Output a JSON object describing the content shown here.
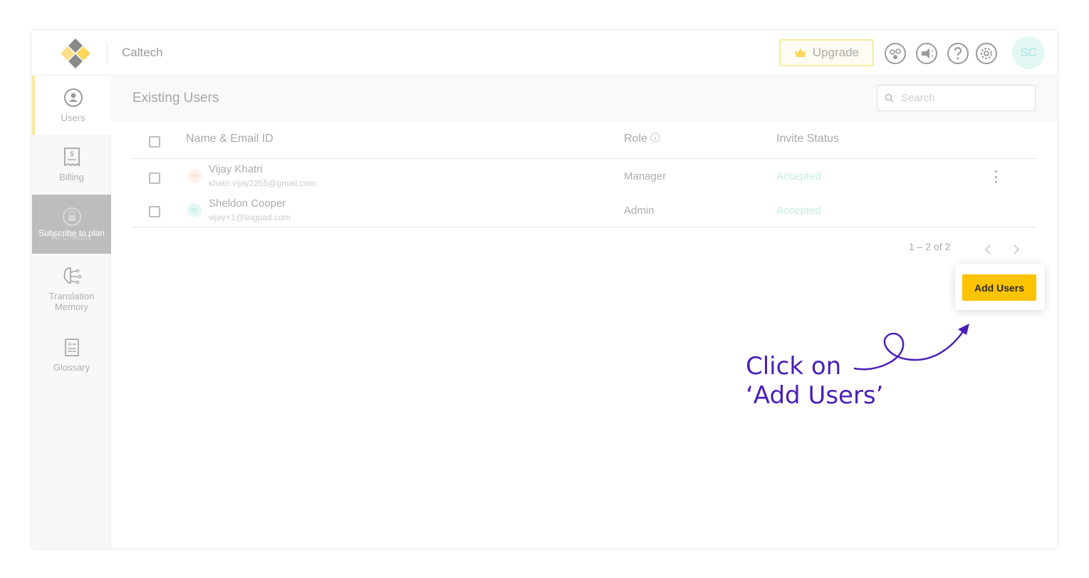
{
  "header": {
    "org_name": "Caltech",
    "upgrade_label": "Upgrade",
    "avatar_initials": "SC"
  },
  "sidebar": {
    "items": [
      {
        "label": "Users",
        "icon": "user-circle-icon",
        "active": true
      },
      {
        "label": "Billing",
        "icon": "receipt-icon",
        "active": false
      },
      {
        "label": "AI Credits",
        "icon": "lock-icon",
        "locked_text": "Subscribe to plan"
      },
      {
        "label": "Translation Memory",
        "icon": "brain-circuit-icon",
        "active": false
      },
      {
        "label": "Glossary",
        "icon": "dictionary-icon",
        "active": false
      }
    ]
  },
  "main": {
    "title": "Existing Users",
    "search_placeholder": "Search",
    "columns": {
      "name": "Name & Email ID",
      "role": "Role",
      "status": "Invite Status"
    },
    "users": [
      {
        "initials": "VK",
        "name": "Vijay Khatri",
        "email": "khatri.vijay2255@gmail.com",
        "role": "Manager",
        "status": "Accepted"
      },
      {
        "initials": "SC",
        "name": "Sheldon Cooper",
        "email": "vijay+1@lingpad.com",
        "role": "Admin",
        "status": "Accepted"
      }
    ],
    "pagination": "1 – 2 of 2",
    "add_button_label": "Add Users"
  },
  "callout": {
    "line1": "Click on",
    "line2": "‘Add Users’"
  },
  "colors": {
    "accent": "#fcc300",
    "callout": "#4a1fb8",
    "status_accepted": "#bfeee3"
  }
}
